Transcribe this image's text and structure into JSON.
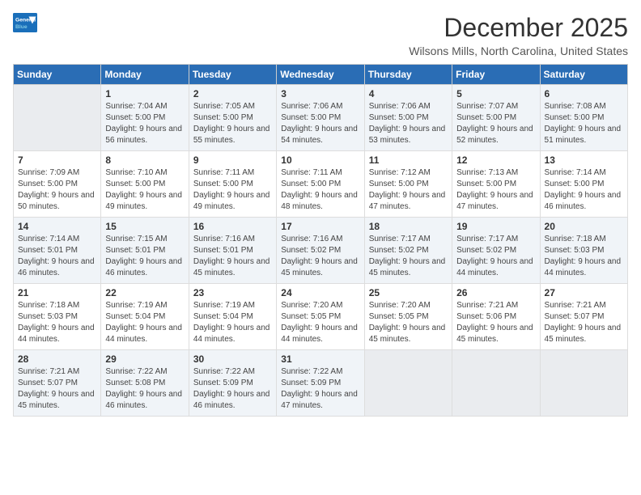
{
  "logo": {
    "general": "General",
    "blue": "Blue"
  },
  "title": "December 2025",
  "location": "Wilsons Mills, North Carolina, United States",
  "weekdays": [
    "Sunday",
    "Monday",
    "Tuesday",
    "Wednesday",
    "Thursday",
    "Friday",
    "Saturday"
  ],
  "weeks": [
    [
      {
        "day": "",
        "sunrise": "",
        "sunset": "",
        "daylight": "",
        "empty": true
      },
      {
        "day": "1",
        "sunrise": "Sunrise: 7:04 AM",
        "sunset": "Sunset: 5:00 PM",
        "daylight": "Daylight: 9 hours and 56 minutes.",
        "empty": false
      },
      {
        "day": "2",
        "sunrise": "Sunrise: 7:05 AM",
        "sunset": "Sunset: 5:00 PM",
        "daylight": "Daylight: 9 hours and 55 minutes.",
        "empty": false
      },
      {
        "day": "3",
        "sunrise": "Sunrise: 7:06 AM",
        "sunset": "Sunset: 5:00 PM",
        "daylight": "Daylight: 9 hours and 54 minutes.",
        "empty": false
      },
      {
        "day": "4",
        "sunrise": "Sunrise: 7:06 AM",
        "sunset": "Sunset: 5:00 PM",
        "daylight": "Daylight: 9 hours and 53 minutes.",
        "empty": false
      },
      {
        "day": "5",
        "sunrise": "Sunrise: 7:07 AM",
        "sunset": "Sunset: 5:00 PM",
        "daylight": "Daylight: 9 hours and 52 minutes.",
        "empty": false
      },
      {
        "day": "6",
        "sunrise": "Sunrise: 7:08 AM",
        "sunset": "Sunset: 5:00 PM",
        "daylight": "Daylight: 9 hours and 51 minutes.",
        "empty": false
      }
    ],
    [
      {
        "day": "7",
        "sunrise": "Sunrise: 7:09 AM",
        "sunset": "Sunset: 5:00 PM",
        "daylight": "Daylight: 9 hours and 50 minutes.",
        "empty": false
      },
      {
        "day": "8",
        "sunrise": "Sunrise: 7:10 AM",
        "sunset": "Sunset: 5:00 PM",
        "daylight": "Daylight: 9 hours and 49 minutes.",
        "empty": false
      },
      {
        "day": "9",
        "sunrise": "Sunrise: 7:11 AM",
        "sunset": "Sunset: 5:00 PM",
        "daylight": "Daylight: 9 hours and 49 minutes.",
        "empty": false
      },
      {
        "day": "10",
        "sunrise": "Sunrise: 7:11 AM",
        "sunset": "Sunset: 5:00 PM",
        "daylight": "Daylight: 9 hours and 48 minutes.",
        "empty": false
      },
      {
        "day": "11",
        "sunrise": "Sunrise: 7:12 AM",
        "sunset": "Sunset: 5:00 PM",
        "daylight": "Daylight: 9 hours and 47 minutes.",
        "empty": false
      },
      {
        "day": "12",
        "sunrise": "Sunrise: 7:13 AM",
        "sunset": "Sunset: 5:00 PM",
        "daylight": "Daylight: 9 hours and 47 minutes.",
        "empty": false
      },
      {
        "day": "13",
        "sunrise": "Sunrise: 7:14 AM",
        "sunset": "Sunset: 5:00 PM",
        "daylight": "Daylight: 9 hours and 46 minutes.",
        "empty": false
      }
    ],
    [
      {
        "day": "14",
        "sunrise": "Sunrise: 7:14 AM",
        "sunset": "Sunset: 5:01 PM",
        "daylight": "Daylight: 9 hours and 46 minutes.",
        "empty": false
      },
      {
        "day": "15",
        "sunrise": "Sunrise: 7:15 AM",
        "sunset": "Sunset: 5:01 PM",
        "daylight": "Daylight: 9 hours and 46 minutes.",
        "empty": false
      },
      {
        "day": "16",
        "sunrise": "Sunrise: 7:16 AM",
        "sunset": "Sunset: 5:01 PM",
        "daylight": "Daylight: 9 hours and 45 minutes.",
        "empty": false
      },
      {
        "day": "17",
        "sunrise": "Sunrise: 7:16 AM",
        "sunset": "Sunset: 5:02 PM",
        "daylight": "Daylight: 9 hours and 45 minutes.",
        "empty": false
      },
      {
        "day": "18",
        "sunrise": "Sunrise: 7:17 AM",
        "sunset": "Sunset: 5:02 PM",
        "daylight": "Daylight: 9 hours and 45 minutes.",
        "empty": false
      },
      {
        "day": "19",
        "sunrise": "Sunrise: 7:17 AM",
        "sunset": "Sunset: 5:02 PM",
        "daylight": "Daylight: 9 hours and 44 minutes.",
        "empty": false
      },
      {
        "day": "20",
        "sunrise": "Sunrise: 7:18 AM",
        "sunset": "Sunset: 5:03 PM",
        "daylight": "Daylight: 9 hours and 44 minutes.",
        "empty": false
      }
    ],
    [
      {
        "day": "21",
        "sunrise": "Sunrise: 7:18 AM",
        "sunset": "Sunset: 5:03 PM",
        "daylight": "Daylight: 9 hours and 44 minutes.",
        "empty": false
      },
      {
        "day": "22",
        "sunrise": "Sunrise: 7:19 AM",
        "sunset": "Sunset: 5:04 PM",
        "daylight": "Daylight: 9 hours and 44 minutes.",
        "empty": false
      },
      {
        "day": "23",
        "sunrise": "Sunrise: 7:19 AM",
        "sunset": "Sunset: 5:04 PM",
        "daylight": "Daylight: 9 hours and 44 minutes.",
        "empty": false
      },
      {
        "day": "24",
        "sunrise": "Sunrise: 7:20 AM",
        "sunset": "Sunset: 5:05 PM",
        "daylight": "Daylight: 9 hours and 44 minutes.",
        "empty": false
      },
      {
        "day": "25",
        "sunrise": "Sunrise: 7:20 AM",
        "sunset": "Sunset: 5:05 PM",
        "daylight": "Daylight: 9 hours and 45 minutes.",
        "empty": false
      },
      {
        "day": "26",
        "sunrise": "Sunrise: 7:21 AM",
        "sunset": "Sunset: 5:06 PM",
        "daylight": "Daylight: 9 hours and 45 minutes.",
        "empty": false
      },
      {
        "day": "27",
        "sunrise": "Sunrise: 7:21 AM",
        "sunset": "Sunset: 5:07 PM",
        "daylight": "Daylight: 9 hours and 45 minutes.",
        "empty": false
      }
    ],
    [
      {
        "day": "28",
        "sunrise": "Sunrise: 7:21 AM",
        "sunset": "Sunset: 5:07 PM",
        "daylight": "Daylight: 9 hours and 45 minutes.",
        "empty": false
      },
      {
        "day": "29",
        "sunrise": "Sunrise: 7:22 AM",
        "sunset": "Sunset: 5:08 PM",
        "daylight": "Daylight: 9 hours and 46 minutes.",
        "empty": false
      },
      {
        "day": "30",
        "sunrise": "Sunrise: 7:22 AM",
        "sunset": "Sunset: 5:09 PM",
        "daylight": "Daylight: 9 hours and 46 minutes.",
        "empty": false
      },
      {
        "day": "31",
        "sunrise": "Sunrise: 7:22 AM",
        "sunset": "Sunset: 5:09 PM",
        "daylight": "Daylight: 9 hours and 47 minutes.",
        "empty": false
      },
      {
        "day": "",
        "sunrise": "",
        "sunset": "",
        "daylight": "",
        "empty": true
      },
      {
        "day": "",
        "sunrise": "",
        "sunset": "",
        "daylight": "",
        "empty": true
      },
      {
        "day": "",
        "sunrise": "",
        "sunset": "",
        "daylight": "",
        "empty": true
      }
    ]
  ]
}
